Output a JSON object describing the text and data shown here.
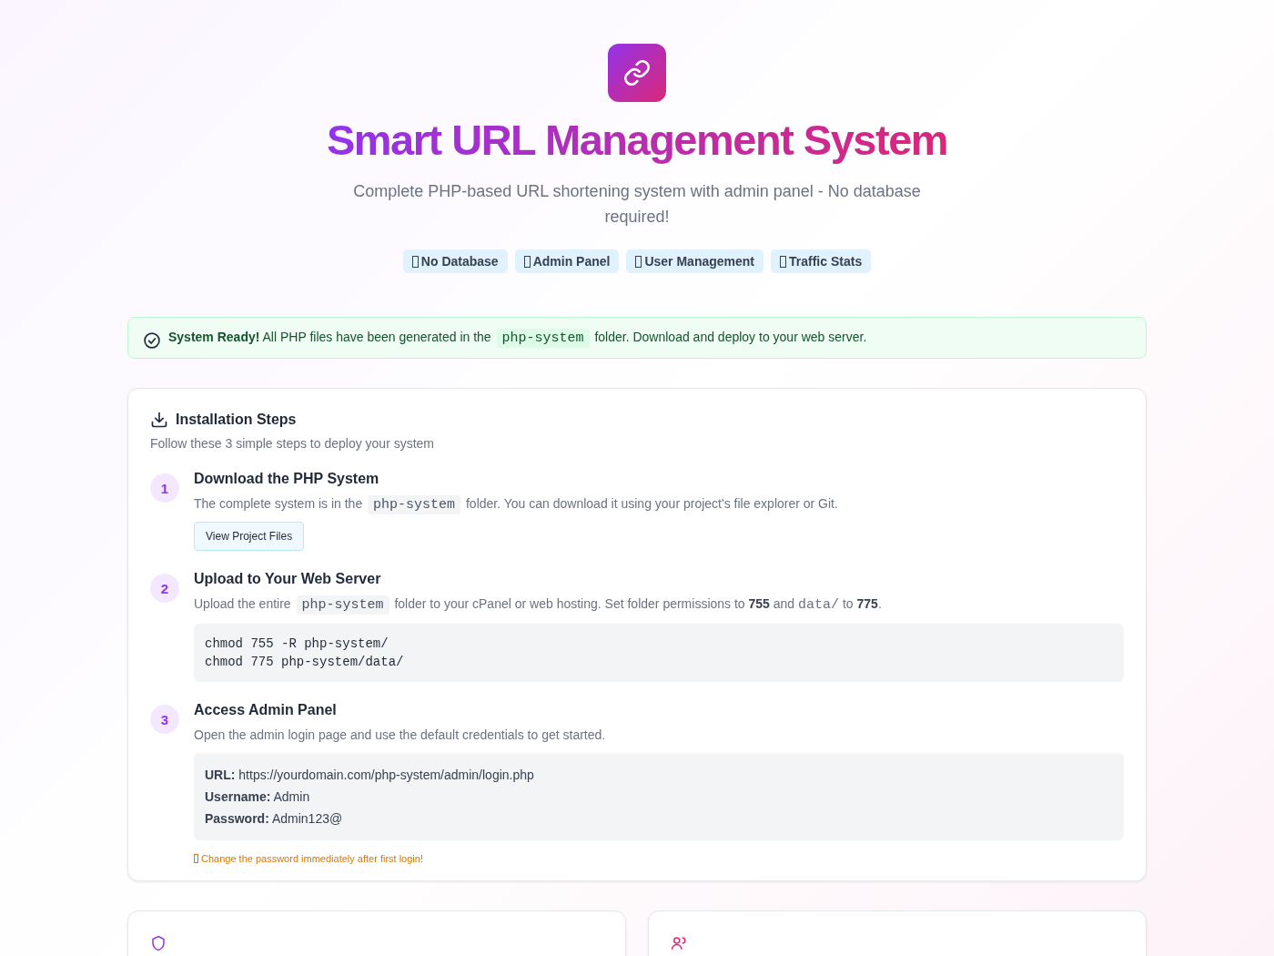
{
  "header": {
    "title": "Smart URL Management System",
    "subtitle": "Complete PHP-based URL shortening system with admin panel - No database required!",
    "badges": [
      {
        "label": "No Database"
      },
      {
        "label": "Admin Panel"
      },
      {
        "label": "User Management"
      },
      {
        "label": "Traffic Stats"
      }
    ]
  },
  "alert": {
    "segments": [
      {
        "kind": "text",
        "text": "**System Ready!** All PHP files have been generated in the "
      },
      {
        "kind": "code",
        "text": "php-system"
      },
      {
        "kind": "text",
        "text": " folder. Download and deploy to your web server."
      }
    ]
  },
  "install": {
    "title": "Installation Steps",
    "description": "Follow these 3 simple steps to deploy your system",
    "steps": [
      {
        "number": "1",
        "title": "Download the PHP System",
        "segments": [
          {
            "kind": "text",
            "text": "The complete system is in the "
          },
          {
            "kind": "code",
            "text": "php-system"
          },
          {
            "kind": "text",
            "text": " folder. You can download it using your project's file explorer or Git."
          }
        ],
        "button": "View Project Files"
      },
      {
        "number": "2",
        "title": "Upload to Your Web Server",
        "segments": [
          {
            "kind": "text",
            "text": "Upload the entire "
          },
          {
            "kind": "code",
            "text": "php-system"
          },
          {
            "kind": "text",
            "text": " folder to your cPanel or web hosting. Set folder permissions to **755** and "
          },
          {
            "kind": "mono",
            "text": "data/"
          },
          {
            "kind": "text",
            "text": " to **775**."
          }
        ],
        "code_lines": [
          "chmod 755 -R php-system/",
          "chmod 775 php-system/data/"
        ]
      },
      {
        "number": "3",
        "title": "Access Admin Panel",
        "segments": [
          {
            "kind": "text",
            "text": "Open the admin login page and use the default credentials to get started."
          }
        ],
        "credentials": [
          "**URL:** https://yourdomain.com/php-system/admin/login.php",
          "**Username:** Admin",
          "**Password:** Admin123@"
        ],
        "warning": "Change the password immediately after first login!"
      }
    ]
  },
  "feature_cards": [
    {
      "kind": "admin"
    },
    {
      "kind": "user"
    }
  ]
}
